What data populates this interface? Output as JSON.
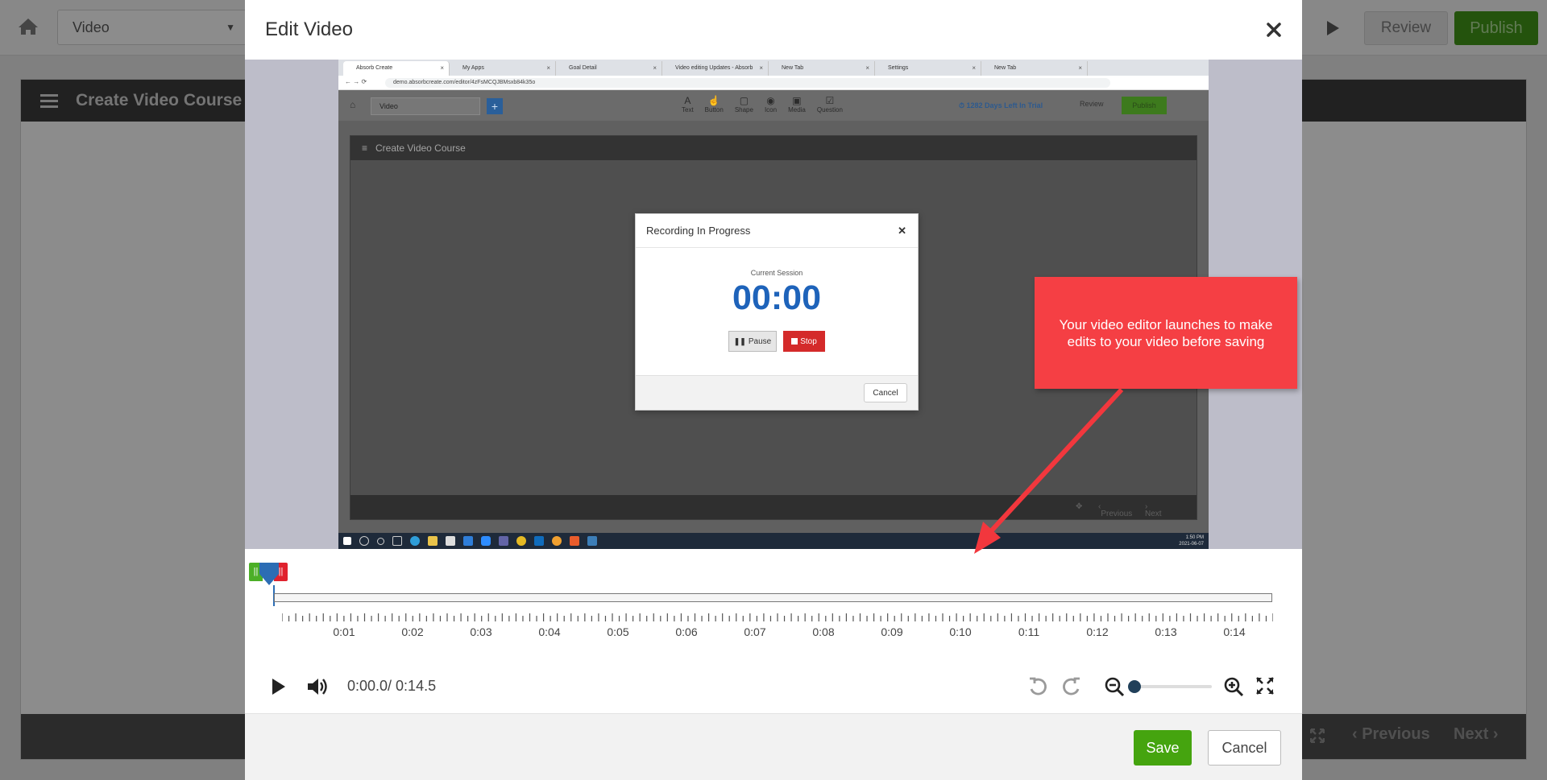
{
  "app": {
    "page_select_value": "Video",
    "review_label": "Review",
    "publish_label": "Publish",
    "course_title": "Create Video Course",
    "footer_prev_label": "Previous",
    "footer_next_label": "Next"
  },
  "modal": {
    "title": "Edit Video",
    "save_label": "Save",
    "cancel_label": "Cancel"
  },
  "video_content": {
    "browser_tabs": [
      "Absorb Create",
      "My Apps",
      "Goal Detail",
      "Video editing Updates - Absorb",
      "New Tab",
      "Settings",
      "New Tab"
    ],
    "url": "demo.absorbcreate.com/editor/4zFsMCQJBMsxb84k35o",
    "select_value": "Video",
    "tools": [
      {
        "icon": "text-icon",
        "label": "Text"
      },
      {
        "icon": "button-icon",
        "label": "Button"
      },
      {
        "icon": "shape-icon",
        "label": "Shape"
      },
      {
        "icon": "icon-icon",
        "label": "Icon"
      },
      {
        "icon": "media-icon",
        "label": "Media"
      },
      {
        "icon": "question-icon",
        "label": "Question"
      }
    ],
    "trial_text": "1282 Days Left In Trial",
    "review_label": "Review",
    "publish_label": "Publish",
    "course_title": "Create Video Course",
    "prev_label": "Previous",
    "next_label": "Next",
    "clock_time": "1:50 PM",
    "clock_date": "2021-06-07",
    "recording_dialog": {
      "title": "Recording In Progress",
      "session_label": "Current Session",
      "timer": "00:00",
      "pause_label": "Pause",
      "stop_label": "Stop",
      "cancel_label": "Cancel"
    }
  },
  "callout": {
    "text": "Your video editor launches to make edits to your video before saving",
    "color": "#f53f44"
  },
  "timeline": {
    "tick_labels": [
      "0:01",
      "0:02",
      "0:03",
      "0:04",
      "0:05",
      "0:06",
      "0:07",
      "0:08",
      "0:09",
      "0:10",
      "0:11",
      "0:12",
      "0:13",
      "0:14"
    ],
    "duration_seconds": 14.5,
    "current_seconds": 0.0
  },
  "controls": {
    "time_display": "0:00.0/ 0:14.5",
    "zoom_level": 0
  }
}
